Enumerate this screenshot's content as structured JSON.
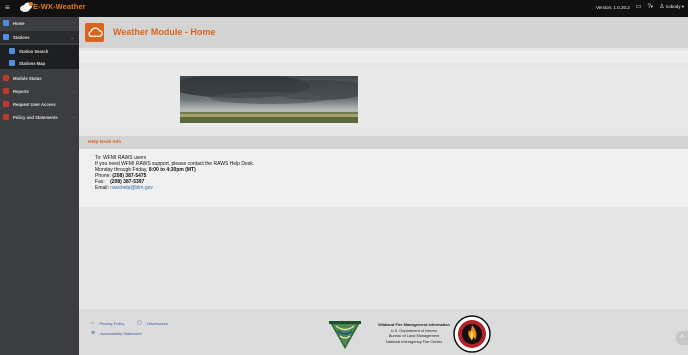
{
  "topbar": {
    "brand": "E-WX-Weather",
    "version": "Version: 1.0.20.2",
    "user": "nobody ▾",
    "help_caret": "▾"
  },
  "sidebar": {
    "items": [
      {
        "label": "Home",
        "icon": "home-icon",
        "color": "#4a8fe0"
      },
      {
        "label": "Stations",
        "icon": "station-icon",
        "color": "#4a8fe0"
      },
      {
        "label": "Station Search",
        "icon": "search-icon",
        "color": "#4a8fe0"
      },
      {
        "label": "Stations Map",
        "icon": "map-icon",
        "color": "#4a8fe0"
      },
      {
        "label": "Module Status",
        "icon": "status-icon",
        "color": "#c0392b"
      },
      {
        "label": "Reports",
        "icon": "report-icon",
        "color": "#c0392b"
      },
      {
        "label": "Request User Access",
        "icon": "user-access-icon",
        "color": "#c0392b"
      },
      {
        "label": "Policy and Statements",
        "icon": "policy-icon",
        "color": "#c0392b"
      }
    ]
  },
  "main": {
    "module_title": "Weather Module - Home"
  },
  "help": {
    "title": "Help Desk Info",
    "line1": "To: WFMI RAWS users",
    "line2": "If you need WFMI RAWS support, please contact the RAWS Help Desk.",
    "line3_prefix": "Monday through Friday, ",
    "hours": "8:00 to 4:30pm (MT)",
    "phone_label": "Phone: ",
    "phone": "(208) 387-5475",
    "fax_label": "Fax:   ",
    "fax": "(208) 387-5397",
    "email_label": "Email: ",
    "email": "rawshelp@blm.gov"
  },
  "footer": {
    "privacy": "- Privacy Policy",
    "disclosures": "- Disclosures",
    "accessibility": "- Accessibility Statement",
    "org_title": "Wildland Fire Management Information",
    "org_line2": "U.S. Department of Interior",
    "org_line3": "Bureau of Land Management",
    "org_line4": "National Interagency Fire Center"
  },
  "colors": {
    "accent": "#d9641e",
    "link": "#3a5ba6",
    "sidebar": "#3b3d40",
    "topbar": "#111111"
  }
}
